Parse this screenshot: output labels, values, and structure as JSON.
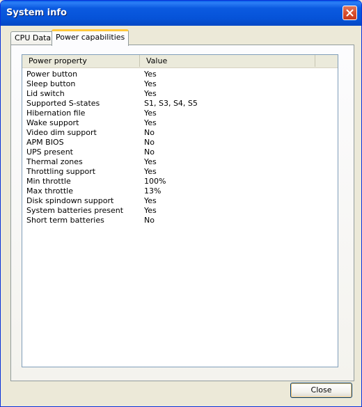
{
  "window": {
    "title": "System info"
  },
  "tabs": [
    {
      "label": "CPU Data",
      "active": false
    },
    {
      "label": "Power capabilities",
      "active": true
    }
  ],
  "list": {
    "columns": [
      "Power property",
      "Value"
    ],
    "rows": [
      {
        "property": "Power button",
        "value": "Yes"
      },
      {
        "property": "Sleep button",
        "value": "Yes"
      },
      {
        "property": "Lid switch",
        "value": "Yes"
      },
      {
        "property": "Supported S-states",
        "value": "S1, S3, S4, S5"
      },
      {
        "property": "Hibernation file",
        "value": "Yes"
      },
      {
        "property": "Wake support",
        "value": "Yes"
      },
      {
        "property": "Video dim support",
        "value": "No"
      },
      {
        "property": "APM BIOS",
        "value": "No"
      },
      {
        "property": "UPS present",
        "value": "No"
      },
      {
        "property": "Thermal zones",
        "value": "Yes"
      },
      {
        "property": "Throttling support",
        "value": "Yes"
      },
      {
        "property": "Min throttle",
        "value": "100%"
      },
      {
        "property": "Max throttle",
        "value": "13%"
      },
      {
        "property": "Disk spindown support",
        "value": "Yes"
      },
      {
        "property": "System batteries present",
        "value": "Yes"
      },
      {
        "property": "Short term batteries",
        "value": "No"
      }
    ]
  },
  "buttons": {
    "close_label": "Close"
  },
  "icons": {
    "title_close": "close-icon"
  },
  "colors": {
    "titlebar": "#0653d8",
    "active_tab_accent": "#ffc83c",
    "close_button": "#d8502f"
  }
}
